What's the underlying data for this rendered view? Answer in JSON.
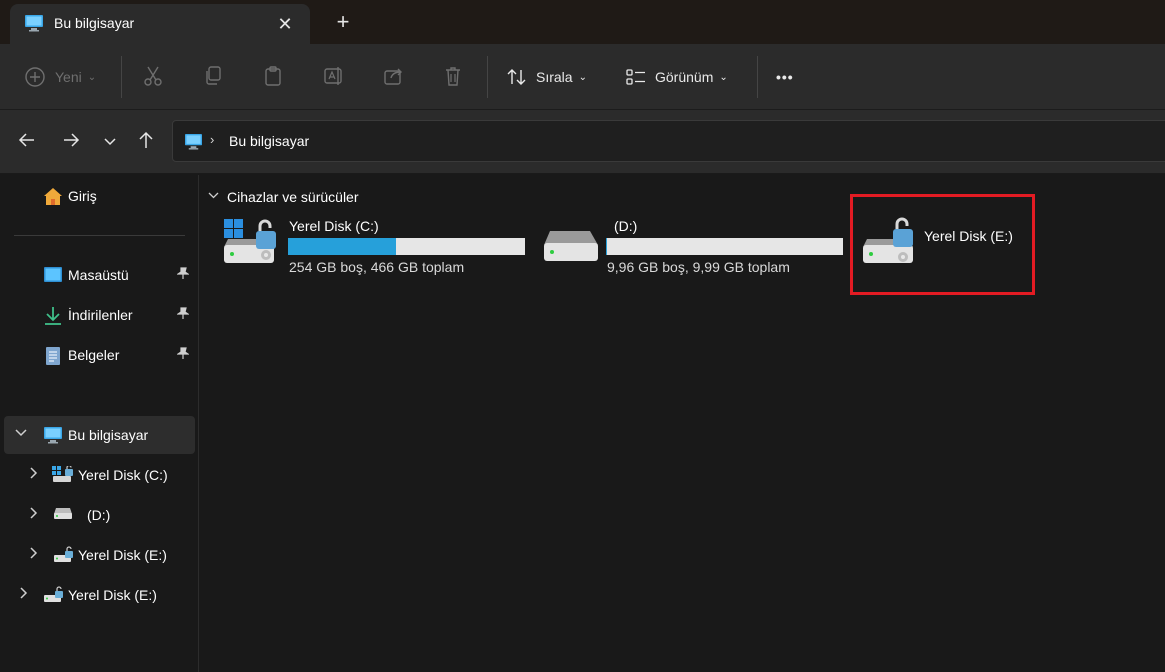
{
  "window": {
    "tab_title": "Bu bilgisayar",
    "close_glyph": "✕",
    "new_tab_glyph": "+"
  },
  "toolbar": {
    "new_label": "Yeni",
    "sort_label": "Sırala",
    "view_label": "Görünüm",
    "more_glyph": "•••"
  },
  "address": {
    "path": "Bu bilgisayar",
    "separator": "›"
  },
  "sidebar": {
    "home": "Giriş",
    "pinned": [
      {
        "label": "Masaüstü"
      },
      {
        "label": "İndirilenler"
      },
      {
        "label": "Belgeler"
      }
    ],
    "this_pc": "Bu bilgisayar",
    "this_pc_children": [
      {
        "label": "Yerel Disk (C:)"
      },
      {
        "label": "(D:)"
      },
      {
        "label": "Yerel Disk (E:)"
      }
    ],
    "extra_drive": "Yerel Disk (E:)"
  },
  "main": {
    "group_title": "Cihazlar ve sürücüler",
    "drives": [
      {
        "name": "Yerel Disk (C:)",
        "info": "254 GB boş, 466 GB toplam",
        "used_fraction": 0.455
      },
      {
        "name": "(D:)",
        "info": "9,96 GB boş, 9,99 GB toplam",
        "used_fraction": 0.003
      },
      {
        "name": "Yerel Disk (E:)",
        "info": "",
        "used_fraction": null
      }
    ]
  },
  "colors": {
    "accent": "#26a0da",
    "highlight": "#e31b23",
    "background": "#191919",
    "toolbar": "#2b2b2b"
  }
}
